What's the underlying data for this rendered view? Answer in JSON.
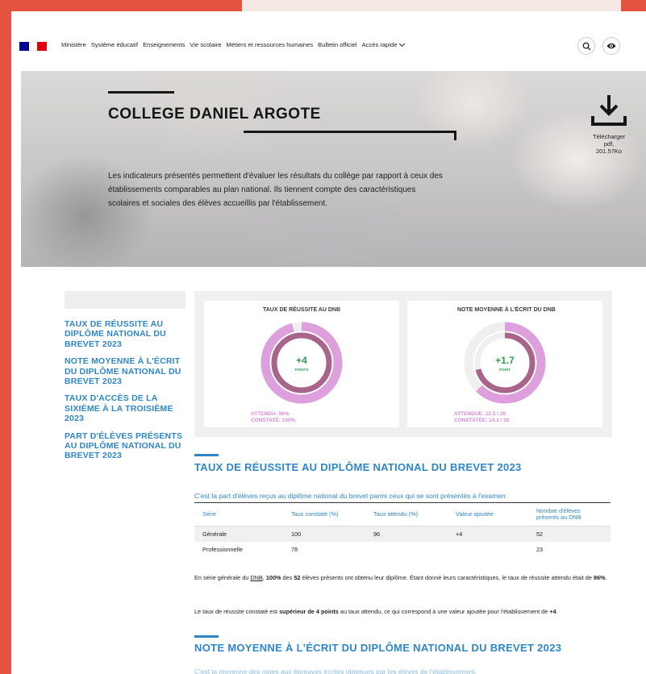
{
  "nav": {
    "items": [
      "Ministère",
      "Système éducatif",
      "Enseignements",
      "Vie scolaire",
      "Métiers et ressources humaines",
      "Bulletin officiel",
      "Accès rapide"
    ],
    "search_icon": "search-icon",
    "eye_icon": "eye-icon"
  },
  "hero": {
    "title": "COLLEGE DANIEL ARGOTE",
    "description": "Les indicateurs présentés permettent d'évaluer les résultats du collège par rapport à ceux des établissements comparables au plan national. Ils tiennent compte des caractéristiques scolaires et sociales des élèves accueillis par l'établissement.",
    "download": {
      "label": "Télécharger",
      "format": "pdf,",
      "size": "201.57Ko"
    }
  },
  "sidebar": {
    "items": [
      "TAUX DE RÉUSSITE AU DIPLÔME NATIONAL DU BREVET 2023",
      "NOTE MOYENNE À L'ÉCRIT DU DIPLÔME NATIONAL DU BREVET 2023",
      "TAUX D'ACCÈS DE LA SIXIÈME À LA TROISIÈME 2023",
      "PART D'ÉLÈVES PRÉSENTS AU DIPLÔME NATIONAL DU BREVET 2023"
    ]
  },
  "cards": [
    {
      "title": "TAUX DE RÉUSSITE AU DNB",
      "value": "+4",
      "unit": "POINTS",
      "expected": "ATTENDU: 96%",
      "observed": "CONSTATÉ: 100%",
      "expected_fraction": 0.96,
      "observed_fraction": 1.0
    },
    {
      "title": "NOTE MOYENNE À L'ÉCRIT DU DNB",
      "value": "+1.7",
      "unit": "POINT",
      "expected": "ATTENDUE: 12.5 / 20",
      "observed": "CONSTATÉE: 14.2 / 20",
      "expected_fraction": 0.625,
      "observed_fraction": 0.71
    }
  ],
  "colors": {
    "accent": "#2e86c9",
    "outer_ring": "#dda0dc",
    "inner_ring": "#a8648a",
    "value": "#2e9e4f",
    "frame": "#e4533f"
  },
  "section1": {
    "title": "TAUX DE RÉUSSITE AU DIPLÔME NATIONAL DU BREVET 2023",
    "intro": "C'est la part d'élèves reçus au diplôme national du brevet parmi ceux qui se sont présentés à l'examen.",
    "table": {
      "headers": [
        "Série",
        "Taux constaté (%)",
        "Taux attendu (%)",
        "Valeur ajoutée",
        "Nombre d'élèves présents au DNB"
      ],
      "rows": [
        [
          "Générale",
          "100",
          "96",
          "+4",
          "52"
        ],
        [
          "Professionnelle",
          "78",
          "",
          "",
          "23"
        ]
      ]
    },
    "para1": {
      "a": "En série générale du ",
      "link": "DNB",
      "b": ", ",
      "c": "100%",
      "d": " des ",
      "e": "52",
      "f": " élèves présents ont obtenu leur diplôme. Étant donné leurs caractéristiques, le taux de réussite attendu était de ",
      "g": "96%",
      "h": "."
    },
    "para2": {
      "a": "Le taux de réussite constaté est ",
      "b": "supérieur de 4 points",
      "c": " au taux attendu, ce qui correspond à une valeur ajoutée pour l'établissement de ",
      "d": "+4",
      "e": "."
    }
  },
  "section2": {
    "title": "NOTE MOYENNE À L'ÉCRIT DU DIPLÔME NATIONAL DU BREVET 2023",
    "intro": "C'est la moyenne des notes aux épreuves écrites obtenues par les élèves de l'établissement."
  }
}
